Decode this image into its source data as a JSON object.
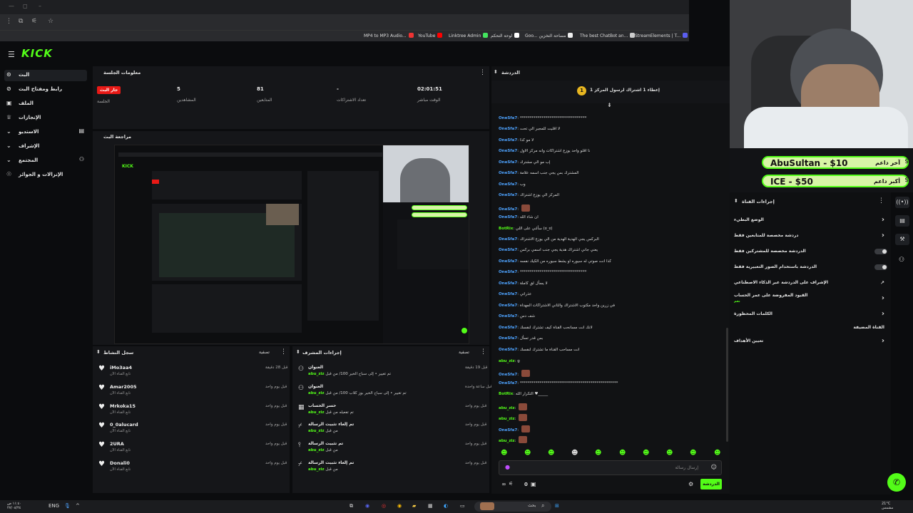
{
  "browser": {
    "bookmarks": [
      "MP4 to MP3 Audio...",
      "YouTube",
      "Linktree Admin",
      "لوحة التحكم",
      "Goo... مساحة التخزين",
      "The best ChatBot an...",
      "StreamElements | T..."
    ]
  },
  "sidebar": {
    "items": [
      {
        "label": "البث",
        "icon": "home-icon"
      },
      {
        "label": "رابط ومفتاح البث",
        "icon": "key-icon"
      },
      {
        "label": "الملف",
        "icon": "profile-icon"
      },
      {
        "label": "الإنجازات",
        "icon": "trophy-icon"
      },
      {
        "label": "الاستديو",
        "icon": "studio-icon"
      },
      {
        "label": "الإشراف",
        "icon": "shield-icon"
      },
      {
        "label": "المجتمع",
        "icon": "community-icon"
      },
      {
        "label": "الإنزالات و الجوائز",
        "icon": "gift-icon"
      }
    ]
  },
  "session": {
    "title": "معلومات الجلسة",
    "live_badge": "جار البث",
    "stats": [
      {
        "label": "الجلسة",
        "value": ""
      },
      {
        "label": "المشاهدين",
        "value": "5"
      },
      {
        "label": "المتابعين",
        "value": "81"
      },
      {
        "label": "تعداد الاشتراكات",
        "value": "-"
      },
      {
        "label": "الوقت مباشر",
        "value": "02:01:51"
      }
    ]
  },
  "preview": {
    "title": "مراجعة البث"
  },
  "activity": {
    "title": "سجل النشاط",
    "filter": "تصفية",
    "items": [
      {
        "name": "iMo3aa4",
        "sub": "تابع القناة الآن",
        "time": "قبل 28 دقيقة"
      },
      {
        "name": "Amar2005",
        "sub": "تابع القناة الآن",
        "time": "قبل يوم واحد"
      },
      {
        "name": "Mrkoka15",
        "sub": "تابع القناة الآن",
        "time": "قبل يوم واحد"
      },
      {
        "name": "0_0alucard",
        "sub": "تابع القناة الآن",
        "time": "قبل يوم واحد"
      },
      {
        "name": "2URA",
        "sub": "تابع القناة الآن",
        "time": "قبل يوم واحد"
      },
      {
        "name": "Donali0",
        "sub": "تابع القناة الآن",
        "time": "قبل يوم واحد"
      }
    ]
  },
  "mod": {
    "title": "إجراءات المشرف",
    "filter": "تصفية",
    "items": [
      {
        "title": "العنوان",
        "by": "abu_ziz",
        "text": "تم تغيير • إلى سباح الخير 100/ من قبل",
        "time": "قبل 19 دقيقة",
        "icon": "edit-icon"
      },
      {
        "title": "العنوان",
        "by": "abu_ziz",
        "text": "تم تغيير • إلى سباح الخير بوز كلاب 100/ من قبل",
        "time": "قبل ساعة واحدة",
        "icon": "edit-icon"
      },
      {
        "title": "حسر الحساب",
        "by": "abu_ziz",
        "text": "تم تفعيله من قبل",
        "time": "قبل يوم واحد",
        "icon": "calendar-icon"
      },
      {
        "title": "تم إلغاء تثبيت الرسالة",
        "by": "abu_ziz",
        "text": "من قبل",
        "time": "قبل يوم واحد",
        "icon": "unpin-icon"
      },
      {
        "title": "تم تثبيت الرسالة",
        "by": "abu_ziz",
        "text": "من قبل",
        "time": "قبل يوم واحد",
        "icon": "pin-icon"
      },
      {
        "title": "تم إلغاء تثبيت الرسالة",
        "by": "abu_ziz",
        "text": "من قبل",
        "time": "قبل يوم واحد",
        "icon": "unpin-icon"
      }
    ]
  },
  "chat": {
    "title": "الدردشة",
    "pinned": "إعطاء 1 اشتراك لرسول المركز 1",
    "messages": [
      {
        "user": "OneSfa7",
        "text": "**********************************",
        "color": "blue"
      },
      {
        "user": "OneSfa7",
        "text": "لا اقليت للمجبر الي تحت",
        "color": "blue"
      },
      {
        "user": "OneSfa7",
        "text": "لا مو كذا",
        "color": "blue"
      },
      {
        "user": "OneSfa7",
        "text": "نا اقلو واحد يوزع اشتراكات وانه مركز الاول",
        "color": "blue"
      },
      {
        "user": "OneSfa7",
        "text": "إب مو الي مشترك",
        "color": "blue"
      },
      {
        "user": "OneSfa7",
        "text": "المشترك بس يجي جنب اسمه علامة",
        "color": "blue"
      },
      {
        "user": "OneSfa7",
        "text": "وب",
        "color": "blue"
      },
      {
        "user": "OneSfa7",
        "text": "المركز الي يوزع اشتراك",
        "color": "blue"
      },
      {
        "user": "OneSfa7",
        "text": "",
        "color": "blue"
      },
      {
        "user": "OneSfa7",
        "text": "ان شاء الله",
        "color": "blue"
      },
      {
        "user": "BotRix",
        "text": "سألني على اللي (ಠ_ಠ)",
        "color": "green"
      },
      {
        "user": "OneSfa7",
        "text": "البركس يجي الهدية الهدية من الي يوزع الاشتراك",
        "color": "blue"
      },
      {
        "user": "OneSfa7",
        "text": "يعني جاني اشتراك هدية يجي جنب اسمي بركس",
        "color": "blue"
      },
      {
        "user": "OneSfa7",
        "text": "كذا انت صوتي له سيوره او يشط سيوره من الكيك نفسه",
        "color": "blue"
      },
      {
        "user": "OneSfa7",
        "text": "**********************************",
        "color": "blue"
      },
      {
        "user": "OneSfa7",
        "text": "لا يسأل لق كاملة",
        "color": "blue"
      },
      {
        "user": "OneSfa7",
        "text": "عذراتي",
        "color": "blue"
      },
      {
        "user": "OneSfa7",
        "text": "في زرين واحد مكتوب الاشتراك والثاني الاشتراكات المهداة",
        "color": "blue"
      },
      {
        "user": "OneSfa7",
        "text": "شف دس",
        "color": "blue"
      },
      {
        "user": "OneSfa7",
        "text": "لانك انت مسانحب القناة كيف تشترك لنفسك",
        "color": "blue"
      },
      {
        "user": "OneSfa7",
        "text": "بس قدر تسأل",
        "color": "blue"
      },
      {
        "user": "OneSfa7",
        "text": "انت مساحب القناة ما تشترك لنفسك",
        "color": "blue"
      },
      {
        "user": "abu_ziz",
        "text": "g",
        "color": "green"
      },
      {
        "user": "OneSfa7",
        "text": "",
        "color": "blue"
      },
      {
        "user": "OneSfa7",
        "text": "**************************************************",
        "color": "blue"
      },
      {
        "user": "BotRix",
        "text": "التكرار الله ♥_____",
        "color": "green"
      },
      {
        "user": "abu_ziz",
        "text": "",
        "color": "green"
      },
      {
        "user": "abu_ziz",
        "text": "",
        "color": "green"
      },
      {
        "user": "OneSfa7",
        "text": "",
        "color": "blue"
      },
      {
        "user": "abu_ziz",
        "text": "",
        "color": "green"
      }
    ],
    "input_placeholder": "إرسال رسالة",
    "send_label": "الدردشة",
    "viewer_count": "0"
  },
  "donations": [
    {
      "amount": "AbuSultan - $10",
      "label": "آخر داعم"
    },
    {
      "amount": "ICE - $50",
      "label": "أكبر داعم"
    }
  ],
  "channel_actions": {
    "title": "إجراءات القناة",
    "rows": [
      {
        "label": "الوضع البطيء",
        "control": "chevron"
      },
      {
        "label": "دردشة مخصصة للمتابعين فقط",
        "control": "chevron"
      },
      {
        "label": "الدردشة مخصصة للمشتركين فقط",
        "control": "toggle"
      },
      {
        "label": "الدردشة باستخدام الصور التعبيرية فقط",
        "control": "toggle"
      },
      {
        "label": "الإشراف على الدردشة عبر الذكاء الاصطناعي",
        "control": "link"
      },
      {
        "label": "القيود المفروضة على عمر الحساب",
        "control": "chevron"
      },
      {
        "label": "الكلمات المحظورة",
        "control": "chevron"
      },
      {
        "label": "القناة المضيفة",
        "control": "none"
      },
      {
        "label": "تعيين الأهداف",
        "control": "chevron"
      }
    ],
    "hint": "نعم"
  },
  "taskbar": {
    "search": "بحث",
    "lang": "ENG",
    "time": "١١:٤٠ ص",
    "date": "٢٧/٠٨/٢٤",
    "weather": "21°C",
    "weather_sub": "مشمس"
  }
}
